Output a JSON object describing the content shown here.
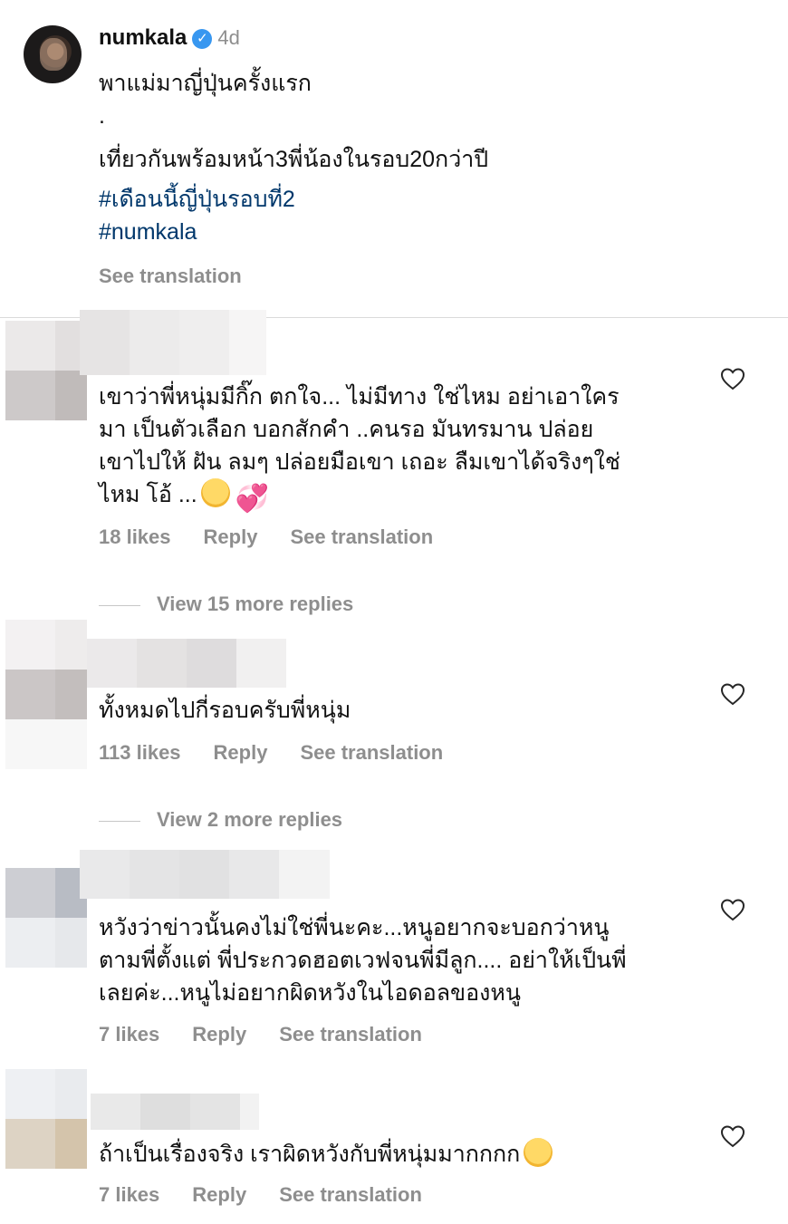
{
  "post": {
    "username": "numkala",
    "verified_icon": "verified-badge-icon",
    "time": "4d",
    "lines": [
      "พาแม่มาญี่ปุ่นครั้งแรก",
      ".",
      "เที่ยวกันพร้อมหน้า3พี่น้องในรอบ20กว่าปี"
    ],
    "hashtags": [
      "#เดือนนี้ญี่ปุ่นรอบที่2",
      "#numkala"
    ],
    "see_translation": "See translation"
  },
  "comments": [
    {
      "text": "เขาว่าพี่หนุ่มมีกิ๊ก ตกใจ... ไม่มีทาง ใช่ไหม อย่าเอาใคร\nมา เป็นตัวเลือก  บอกสักคำ ..คนรอ มันทรมาน ปล่อย\nเขาไปให้ ฝัน ลมๆ  ปล่อยมือเขา เถอะ ลืมเขาได้จริงๆใช่\nไหม  โอ้ ...",
      "emojis": [
        "sad-face-emoji",
        "heart-emoji"
      ],
      "likes": "18 likes",
      "reply": "Reply",
      "see_translation": "See translation",
      "view_replies": "View 15 more replies"
    },
    {
      "text": "ทั้งหมดไปกี่รอบครับพี่หนุ่ม",
      "likes": "113 likes",
      "reply": "Reply",
      "see_translation": "See translation",
      "view_replies": "View 2 more replies"
    },
    {
      "text": "หวังว่าข่าวนั้นคงไม่ใช่พี่นะคะ...หนูอยากจะบอกว่าหนู\nตามพี่ตั้งแต่ พี่ประกวดฮอตเวฟจนพี่มีลูก.... อย่าให้เป็นพี่\nเลยค่ะ...หนูไม่อยากผิดหวังในไอดอลของหนู",
      "likes": "7 likes",
      "reply": "Reply",
      "see_translation": "See translation"
    },
    {
      "text": "ถ้าเป็นเรื่องจริง เราผิดหวังกับพี่หนุ่มมากกกก",
      "emojis": [
        "crying-face-emoji"
      ],
      "likes": "7 likes",
      "reply": "Reply",
      "see_translation": "See translation"
    }
  ],
  "colors": {
    "text": "#111111",
    "secondary": "#8e8e8e",
    "hashtag": "#00376b",
    "verified": "#3897f0",
    "divider": "#dbdbdb"
  }
}
